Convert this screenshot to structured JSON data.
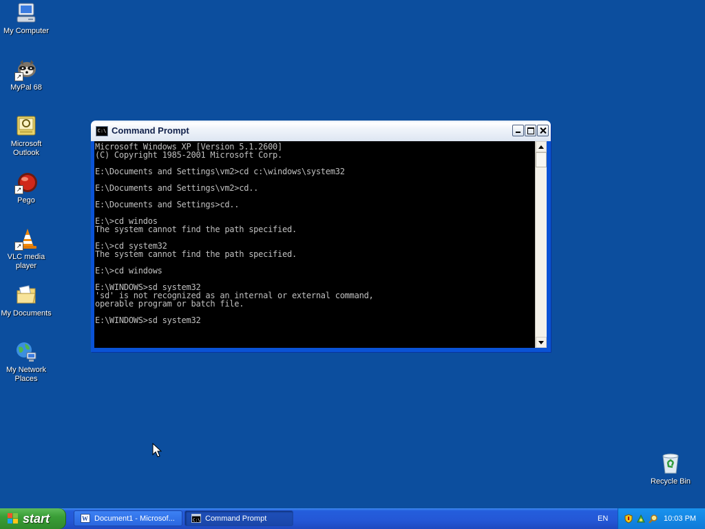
{
  "desktop": {
    "icons": [
      {
        "label": "My Computer"
      },
      {
        "label": "MyPal 68"
      },
      {
        "label": "Microsoft Outlook"
      },
      {
        "label": "Pego"
      },
      {
        "label": "VLC media player"
      },
      {
        "label": "My Documents"
      },
      {
        "label": "My Network Places"
      },
      {
        "label": "Recycle Bin"
      }
    ]
  },
  "window": {
    "title": "Command Prompt",
    "console_lines": [
      "Microsoft Windows XP [Version 5.1.2600]",
      "(C) Copyright 1985-2001 Microsoft Corp.",
      "",
      "E:\\Documents and Settings\\vm2>cd c:\\windows\\system32",
      "",
      "E:\\Documents and Settings\\vm2>cd..",
      "",
      "E:\\Documents and Settings>cd..",
      "",
      "E:\\>cd windos",
      "The system cannot find the path specified.",
      "",
      "E:\\>cd system32",
      "The system cannot find the path specified.",
      "",
      "E:\\>cd windows",
      "",
      "E:\\WINDOWS>sd system32",
      "'sd' is not recognized as an internal or external command,",
      "operable program or batch file.",
      "",
      "E:\\WINDOWS>sd system32"
    ]
  },
  "taskbar": {
    "start_label": "start",
    "tasks": [
      {
        "label": "Document1 - Microsof..."
      },
      {
        "label": "Command Prompt"
      }
    ],
    "language": "EN",
    "clock": "10:03 PM"
  },
  "colors": {
    "desktop": "#0c4e9e",
    "console_bg": "#000000",
    "console_fg": "#c0c0c0"
  }
}
